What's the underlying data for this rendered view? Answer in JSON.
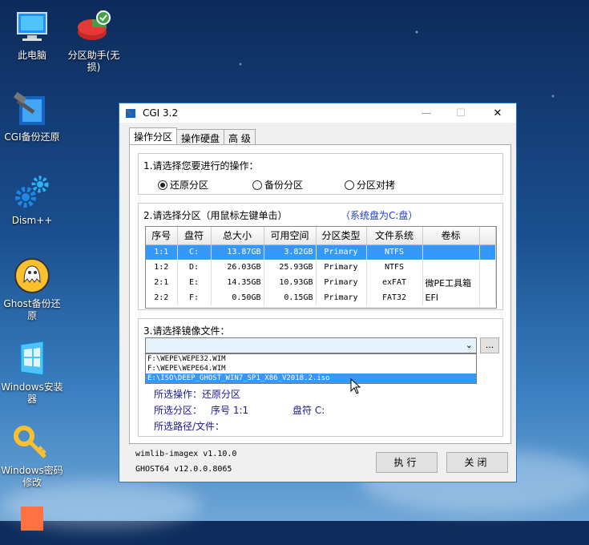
{
  "desktop": {
    "icons": [
      {
        "label": "此电脑",
        "icon": "computer-icon"
      },
      {
        "label": "分区助手(无损)",
        "icon": "partition-assistant-icon"
      },
      {
        "label": "CGI备份还原",
        "icon": "cgi-backup-icon"
      },
      {
        "label": "Dism++",
        "icon": "dism-gear-icon"
      },
      {
        "label": "Ghost备份还原",
        "icon": "ghost-icon"
      },
      {
        "label": "Windows安装器",
        "icon": "windows-installer-icon"
      },
      {
        "label": "Windows密码修改",
        "icon": "key-icon"
      }
    ]
  },
  "window": {
    "title": "CGI 3.2",
    "controls": {
      "minimize": "—",
      "maximize": "☐",
      "close": "✕"
    },
    "tabs": [
      "操作分区",
      "操作硬盘",
      "高 级"
    ],
    "section1": {
      "title": "1.请选择您要进行的操作：",
      "options": [
        "还原分区",
        "备份分区",
        "分区对拷"
      ],
      "selected": 0
    },
    "section2": {
      "title": "2.请选择分区（用鼠标左键单击）",
      "system_note": "（系统盘为C:盘）",
      "columns": [
        "序号",
        "盘符",
        "总大小",
        "可用空间",
        "分区类型",
        "文件系统",
        "卷标"
      ],
      "rows": [
        [
          "1:1",
          "C:",
          "13.87GB",
          "3.82GB",
          "Primary",
          "NTFS",
          ""
        ],
        [
          "1:2",
          "D:",
          "26.03GB",
          "25.93GB",
          "Primary",
          "NTFS",
          ""
        ],
        [
          "2:1",
          "E:",
          "14.35GB",
          "10.93GB",
          "Primary",
          "exFAT",
          "微PE工具箱"
        ],
        [
          "2:2",
          "F:",
          "0.50GB",
          "0.15GB",
          "Primary",
          "FAT32",
          "EFI"
        ]
      ],
      "selected_row": 0
    },
    "section3": {
      "title": "3.请选择镜像文件：",
      "combo_value": "",
      "browse_label": "...",
      "options": [
        "F:\\WEPE\\WEPE32.WIM",
        "F:\\WEPE\\WEPE64.WIM",
        "E:\\ISO\\DEEP_GHOST_WIN7_SP1_X86_V2018.2.iso"
      ],
      "highlighted_option": 2
    },
    "summary": {
      "operation": "所选操作：还原分区",
      "partition_label": "所选分区：",
      "partition_index": "序号 1:1",
      "drive": "盘符 C:",
      "path": "所选路径/文件："
    },
    "versions": [
      "wimlib-imagex v1.10.0",
      "GHOST64 v12.0.0.8065"
    ],
    "buttons": {
      "execute": "执行",
      "close": "关闭"
    }
  },
  "colors": {
    "accent": "#3399ff",
    "window_border": "#2b78c9",
    "summary_text": "#1a1a8a"
  }
}
